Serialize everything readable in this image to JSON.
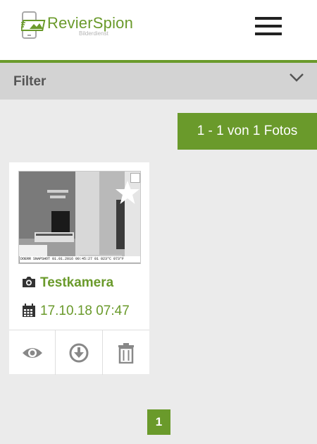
{
  "header": {
    "logo_name": "RevierSpion",
    "logo_subtitle": "Bilderdienst",
    "menu_icon": "hamburger-icon"
  },
  "filter": {
    "label": "Filter",
    "icon": "chevron-down-icon"
  },
  "results": {
    "count_label": "1 - 1 von 1 Fotos"
  },
  "photos": [
    {
      "stamp": "DOERR SNAPSHOT  01.01.2016 00:45:27  01 023°C 073°F",
      "camera_icon": "camera-icon",
      "camera_name": "Testkamera",
      "date_icon": "calendar-icon",
      "date": "17.10.18 07:47",
      "favorite_icon": "star-icon",
      "actions": [
        "eye-icon",
        "download-icon",
        "trash-icon"
      ]
    }
  ],
  "pagination": {
    "current": "1"
  },
  "colors": {
    "brand_green": "#6a9a2b",
    "filter_bg": "#d3d3d3",
    "page_bg": "#ebebeb"
  }
}
